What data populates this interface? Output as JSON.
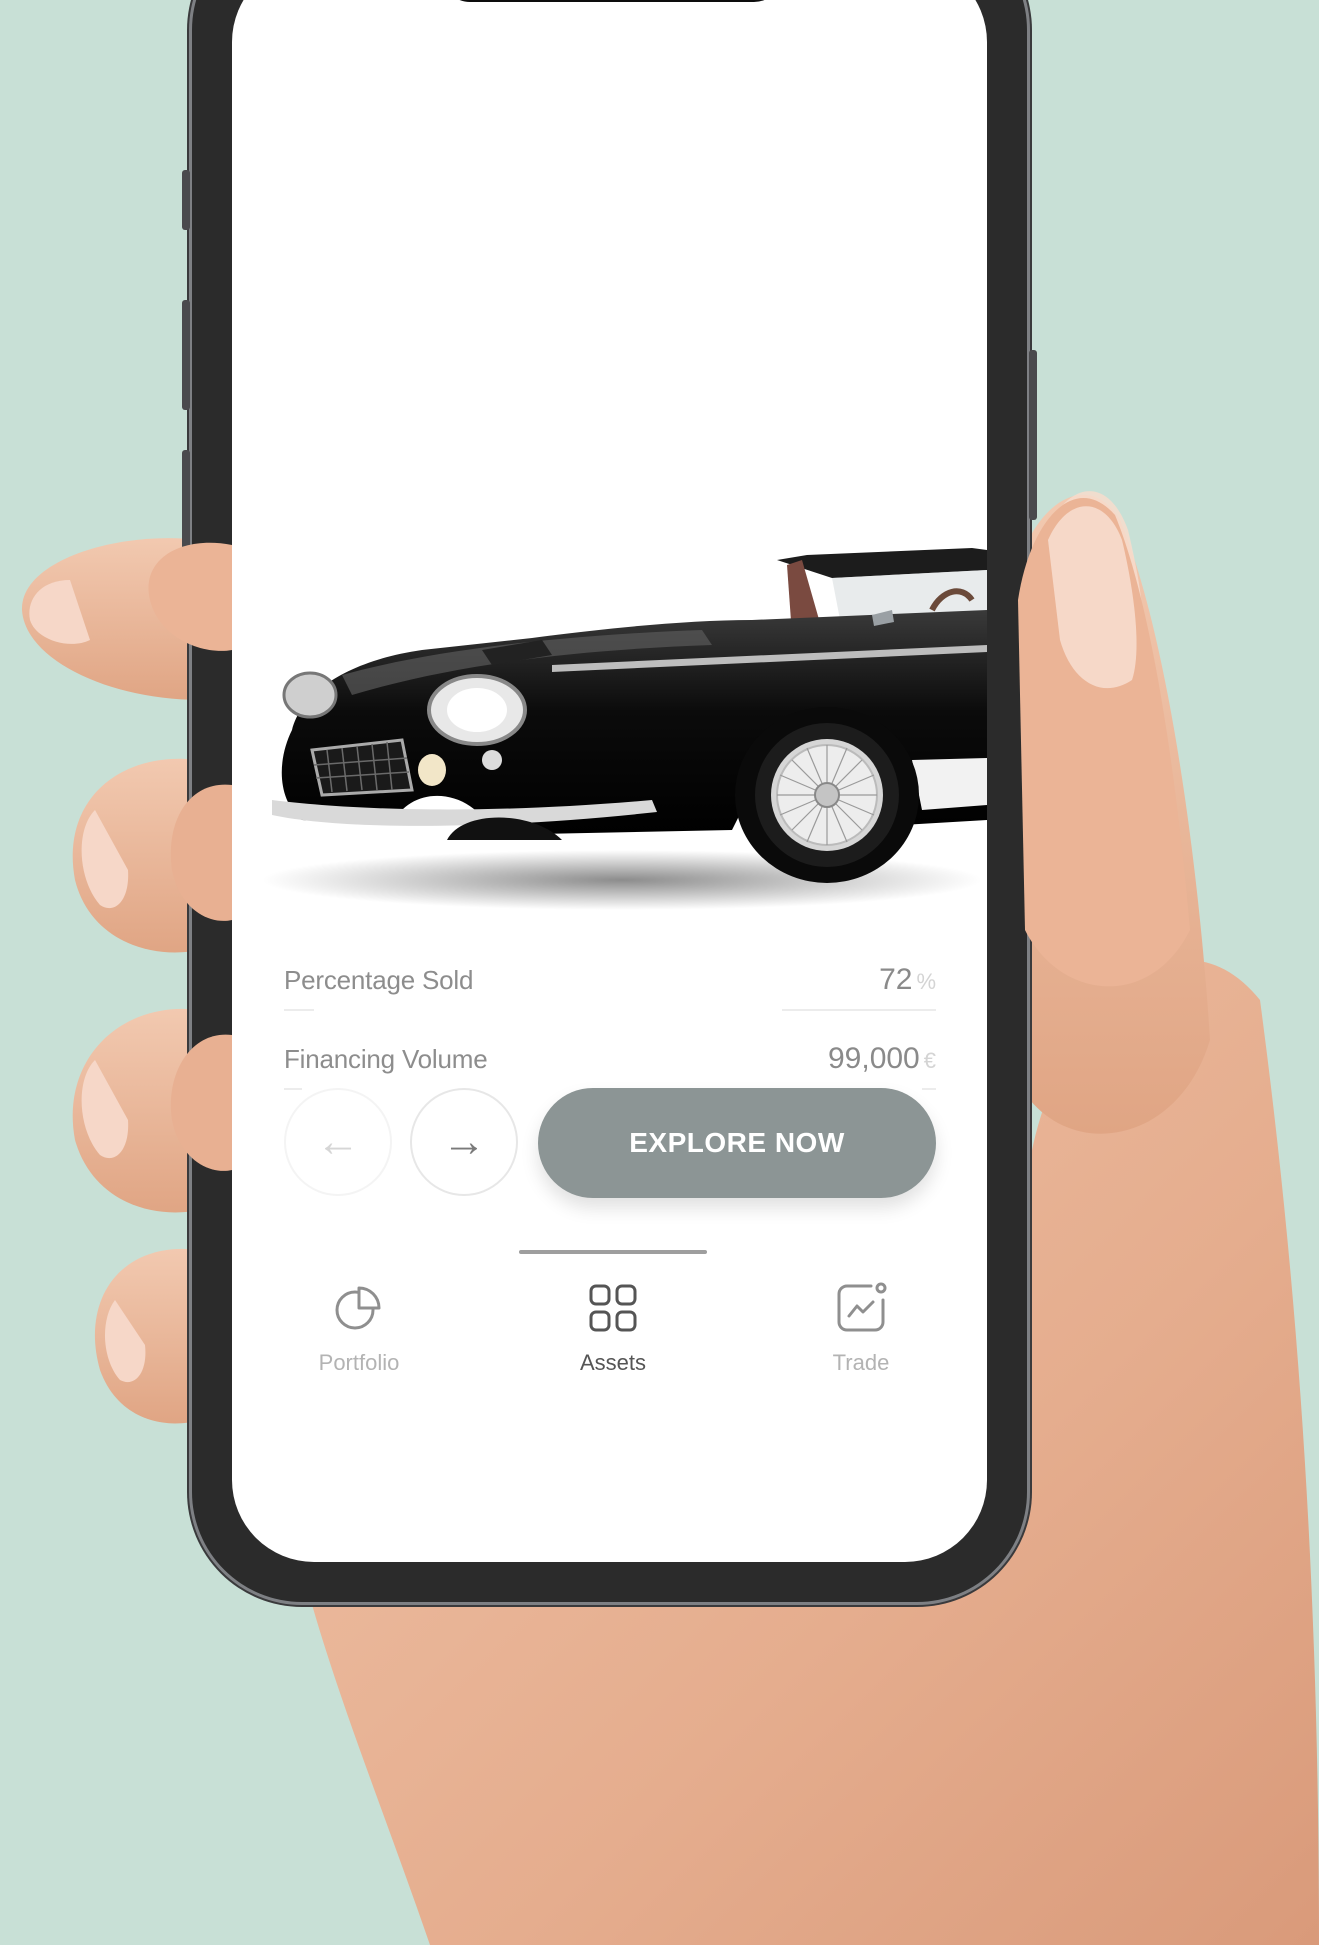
{
  "stats": [
    {
      "label": "Percentage Sold",
      "value": "72",
      "unit": "%"
    },
    {
      "label": "Financing Volume",
      "value": "99,000",
      "unit": "€"
    }
  ],
  "controls": {
    "prev_arrow": "←",
    "next_arrow": "→",
    "explore_label": "EXPLORE NOW"
  },
  "tabs": [
    {
      "label": "Portfolio",
      "icon": "pie-chart-icon",
      "active": false
    },
    {
      "label": "Assets",
      "icon": "grid-icon",
      "active": true
    },
    {
      "label": "Trade",
      "icon": "trend-chart-icon",
      "active": false
    }
  ],
  "colors": {
    "background": "#c8e0d6",
    "button": "#8c9595",
    "skin": "#e9b699"
  }
}
